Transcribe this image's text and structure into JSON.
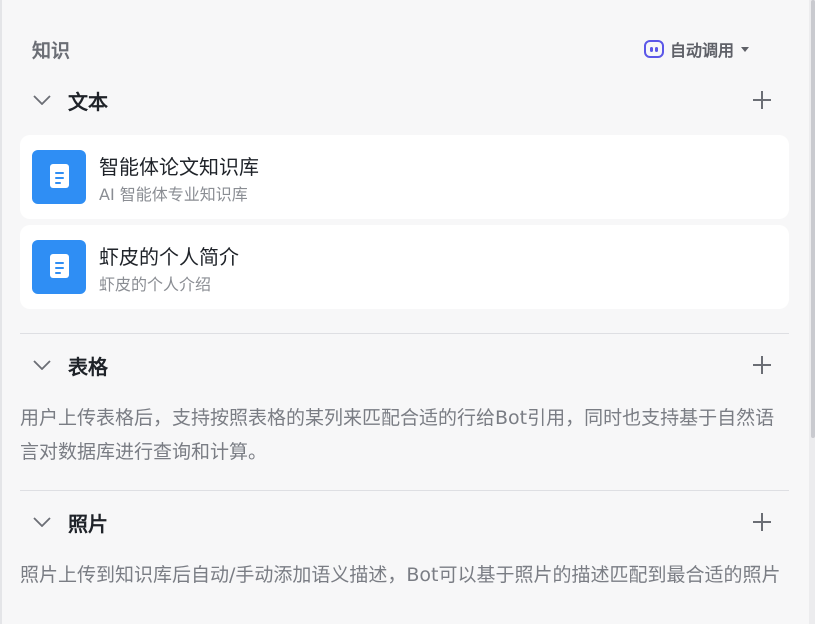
{
  "knowledge": {
    "title": "知识",
    "auto_call_label": "自动调用"
  },
  "text_group": {
    "title": "文本",
    "items": [
      {
        "title": "智能体论文知识库",
        "desc": "AI 智能体专业知识库"
      },
      {
        "title": "虾皮的个人简介",
        "desc": "虾皮的个人介绍"
      }
    ]
  },
  "table_group": {
    "title": "表格",
    "description": "用户上传表格后，支持按照表格的某列来匹配合适的行给Bot引用，同时也支持基于自然语言对数据库进行查询和计算。"
  },
  "photo_group": {
    "title": "照片",
    "description": "照片上传到知识库后自动/手动添加语义描述，Bot可以基于照片的描述匹配到最合适的照片"
  },
  "colors": {
    "accent": "#5b57e8",
    "doc_icon": "#2f8ef4",
    "background": "#f7f7f8"
  }
}
